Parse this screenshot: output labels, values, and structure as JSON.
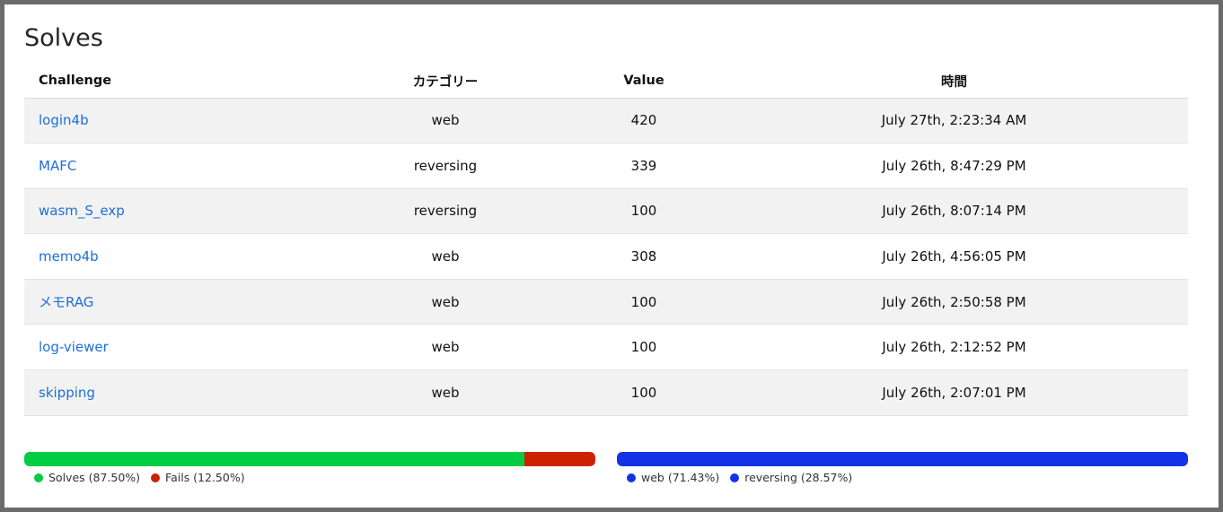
{
  "title": "Solves",
  "columns": [
    "Challenge",
    "カテゴリー",
    "Value",
    "時間"
  ],
  "rows": [
    {
      "challenge": "login4b",
      "category": "web",
      "value": "420",
      "time": "July 27th, 2:23:34 AM"
    },
    {
      "challenge": "MAFC",
      "category": "reversing",
      "value": "339",
      "time": "July 26th, 8:47:29 PM"
    },
    {
      "challenge": "wasm_S_exp",
      "category": "reversing",
      "value": "100",
      "time": "July 26th, 8:07:14 PM"
    },
    {
      "challenge": "memo4b",
      "category": "web",
      "value": "308",
      "time": "July 26th, 4:56:05 PM"
    },
    {
      "challenge": "メモRAG",
      "category": "web",
      "value": "100",
      "time": "July 26th, 2:50:58 PM"
    },
    {
      "challenge": "log-viewer",
      "category": "web",
      "value": "100",
      "time": "July 26th, 2:12:52 PM"
    },
    {
      "challenge": "skipping",
      "category": "web",
      "value": "100",
      "time": "July 26th, 2:07:01 PM"
    }
  ],
  "solve_bar": {
    "segments": [
      {
        "label": "Solves (87.50%)",
        "percent": 87.5,
        "color": "#00cc44"
      },
      {
        "label": "Fails (12.50%)",
        "percent": 12.5,
        "color": "#cc2200"
      }
    ]
  },
  "category_bar": {
    "segments": [
      {
        "label": "web (71.43%)",
        "percent": 71.43,
        "color": "#1533e6"
      },
      {
        "label": "reversing (28.57%)",
        "percent": 28.57,
        "color": "#1533e6"
      }
    ]
  }
}
